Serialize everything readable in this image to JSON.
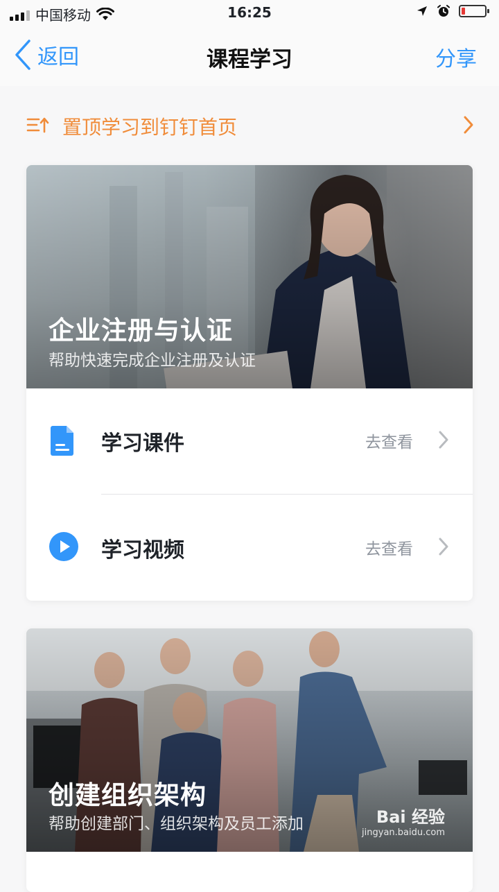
{
  "status_bar": {
    "carrier": "中国移动",
    "time": "16:25",
    "battery_level": 0.15,
    "battery_color": "#e53935"
  },
  "nav": {
    "back_label": "返回",
    "title": "课程学习",
    "share_label": "分享",
    "accent_color": "#3296fa"
  },
  "pin_row": {
    "label": "置顶学习到钉钉首页",
    "color": "#f08c3a",
    "icon": "pin-top-icon"
  },
  "courses": [
    {
      "title": "企业注册与认证",
      "subtitle": "帮助快速完成企业注册及认证",
      "items": [
        {
          "label": "学习课件",
          "action": "去查看",
          "icon": "document-icon"
        },
        {
          "label": "学习视频",
          "action": "去查看",
          "icon": "play-icon"
        }
      ]
    },
    {
      "title": "创建组织架构",
      "subtitle": "帮助创建部门、组织架构及员工添加"
    }
  ],
  "watermark": {
    "brand": "Bai 经验",
    "url": "jingyan.baidu.com"
  }
}
